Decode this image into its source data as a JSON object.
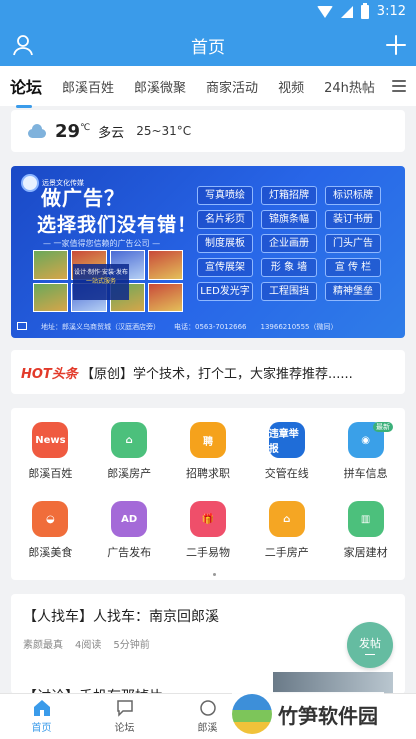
{
  "status": {
    "time": "3:12"
  },
  "header": {
    "title": "首页"
  },
  "tabs": [
    "论坛",
    "郎溪百姓",
    "郎溪微聚",
    "商家活动",
    "视频",
    "24h热帖"
  ],
  "weather": {
    "temp": "29",
    "unit": "℃",
    "condition": "多云",
    "range": "25~31°C"
  },
  "banner": {
    "brand": "远景文化传媒",
    "headline": "做广告？",
    "headline2": "选择我们没有错！",
    "tagline": "— 一家值得您信赖的广告公司 —",
    "service1": "设计·制作·安装·发布",
    "service2": "一站式服务",
    "services": [
      "写真喷绘",
      "灯箱招牌",
      "标识标牌",
      "名片彩页",
      "锦旗条幅",
      "装订书册",
      "制度展板",
      "企业画册",
      "门头广告",
      "宣传展架",
      "形 象 墙",
      "宣 传 栏",
      "LED发光字",
      "工程围挡",
      "精神堡垒"
    ],
    "address": "地址：郎溪义乌商贸城（汉庭酒店旁）",
    "phone": "电话：0563-7012666",
    "mobile": "13966210555（微同）"
  },
  "news": {
    "tag": "HOT头条",
    "text": "【原创】学个技术，打个工，大家推荐推荐......"
  },
  "grid": [
    {
      "label": "郎溪百姓",
      "icon_text": "News",
      "color": "#ef5a40"
    },
    {
      "label": "郎溪房产",
      "icon_text": "⌂",
      "color": "#4cc07c"
    },
    {
      "label": "招聘求职",
      "icon_text": "聘",
      "color": "#f5a21c"
    },
    {
      "label": "交管在线",
      "icon_text": "违章举报",
      "color": "#1f6dd8"
    },
    {
      "label": "拼车信息",
      "icon_text": "◉",
      "color": "#3aa0e8",
      "badge": "最新"
    },
    {
      "label": "郎溪美食",
      "icon_text": "◒",
      "color": "#f06d3a"
    },
    {
      "label": "广告发布",
      "icon_text": "AD",
      "color": "#a46ad8"
    },
    {
      "label": "二手易物",
      "icon_text": "🎁",
      "color": "#ef4f6a"
    },
    {
      "label": "二手房产",
      "icon_text": "⌂",
      "color": "#f5a623"
    },
    {
      "label": "家居建材",
      "icon_text": "▥",
      "color": "#4cc07c"
    }
  ],
  "post": {
    "title": "【人找车】人找车：南京回郎溪",
    "author": "素颜最真",
    "reads": "4阅读",
    "time": "5分钟前",
    "next_title": "【讨论】手机存那掉片"
  },
  "fab": {
    "label": "发帖"
  },
  "bottomnav": [
    "首页",
    "论坛",
    "郎溪"
  ],
  "watermark": "竹笋软件园"
}
